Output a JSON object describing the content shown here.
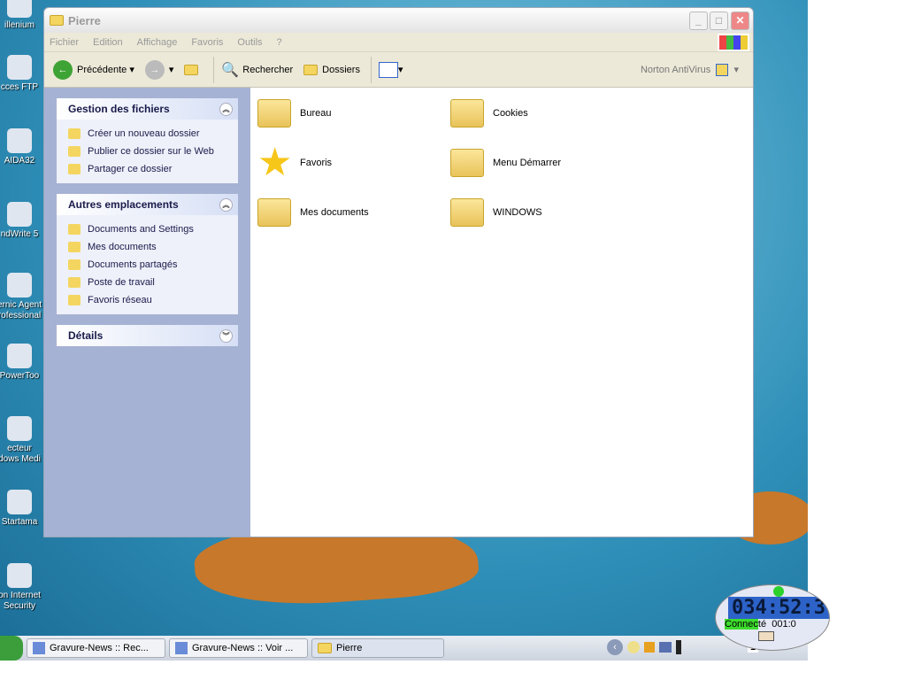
{
  "desktop": {
    "icons": [
      "illenium",
      "cces FTP",
      "AIDA32",
      "ndWrite 5",
      "ernic Agent\nrofessional",
      "PowerToo",
      "ecteur\ndows Medi",
      "Startama",
      "on Internet\nSecurity"
    ]
  },
  "window": {
    "title": "Pierre",
    "menu": [
      "Fichier",
      "Edition",
      "Affichage",
      "Favoris",
      "Outils",
      "?"
    ],
    "toolbar": {
      "back": "Précédente",
      "search": "Rechercher",
      "folders": "Dossiers",
      "norton": "Norton AntiVirus"
    },
    "panels": [
      {
        "title": "Gestion des fichiers",
        "items": [
          "Créer un nouveau dossier",
          "Publier ce dossier sur le Web",
          "Partager ce dossier"
        ]
      },
      {
        "title": "Autres emplacements",
        "items": [
          "Documents and Settings",
          "Mes documents",
          "Documents partagés",
          "Poste de travail",
          "Favoris réseau"
        ]
      },
      {
        "title": "Détails",
        "items": []
      }
    ],
    "items": [
      "Bureau",
      "Cookies",
      "Favoris",
      "Menu Démarrer",
      "Mes documents",
      "WINDOWS"
    ]
  },
  "taskbar": {
    "tasks": [
      "Gravure-News :: Rec...",
      "Gravure-News :: Voir ...",
      "Pierre"
    ],
    "tray_number": "1"
  },
  "meter": {
    "time": "034:52:3",
    "status_hl": "Connec",
    "status_rest": "té",
    "counter": "001:0"
  }
}
